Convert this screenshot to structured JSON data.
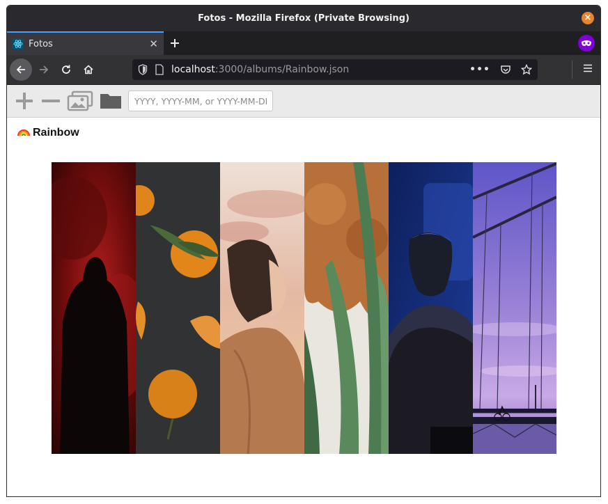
{
  "window": {
    "title": "Fotos - Mozilla Firefox (Private Browsing)"
  },
  "tab": {
    "title": "Fotos"
  },
  "url": {
    "host": "localhost",
    "rest": ":3000/albums/Rainbow.json"
  },
  "toolbar": {
    "date_placeholder": "YYYY, YYYY-MM, or YYYY-MM-DD"
  },
  "album": {
    "emoji": "🌈",
    "title": "Rainbow"
  },
  "photos": [
    {
      "subject": "person in red smoke",
      "accent": "#8b1414"
    },
    {
      "subject": "tangerines on dark slate",
      "accent": "#e08a1e"
    },
    {
      "subject": "woman with pastel sky",
      "accent": "#c98a5c"
    },
    {
      "subject": "aloe plant and curly hair",
      "accent": "#4f7a52"
    },
    {
      "subject": "man in blue light",
      "accent": "#1d3c9a"
    },
    {
      "subject": "bridge at purple dusk",
      "accent": "#8a6fd0"
    }
  ]
}
